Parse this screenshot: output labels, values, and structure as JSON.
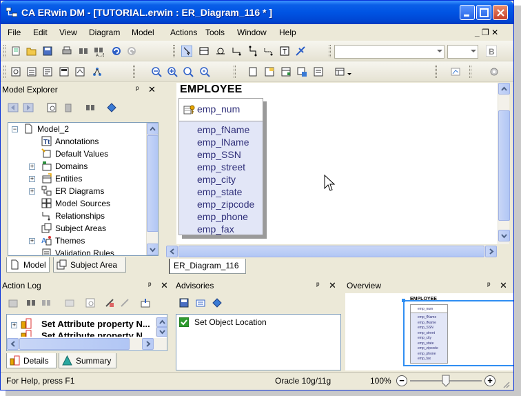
{
  "window": {
    "title": "CA ERwin DM - [TUTORIAL.erwin : ER_Diagram_116 * ]"
  },
  "menu": {
    "items": [
      "File",
      "Edit",
      "View",
      "Diagram",
      "Model",
      "Actions",
      "Tools",
      "Window",
      "Help"
    ],
    "mdi_controls": "_ ❐ ✕"
  },
  "model_explorer": {
    "title": "Model Explorer",
    "root": "Model_2",
    "items": [
      "Annotations",
      "Default Values",
      "Domains",
      "Entities",
      "ER Diagrams",
      "Model Sources",
      "Relationships",
      "Subject Areas",
      "Themes",
      "Validation Rules"
    ],
    "tabs": [
      "Model",
      "Subject Area"
    ]
  },
  "diagram": {
    "tab_label": "ER_Diagram_116",
    "entity": {
      "name": "EMPLOYEE",
      "key": "emp_num",
      "attributes": [
        "emp_fName",
        "emp_lName",
        "emp_SSN",
        "emp_street",
        "emp_city",
        "emp_state",
        "emp_zipcode",
        "emp_phone",
        "emp_fax"
      ]
    }
  },
  "action_log": {
    "title": "Action Log",
    "items": [
      "Set Attribute property N...",
      "Set Attribute property N..."
    ],
    "tabs": [
      "Details",
      "Summary"
    ]
  },
  "advisories": {
    "title": "Advisories",
    "items": [
      "Set Object Location"
    ]
  },
  "overview": {
    "title": "Overview",
    "entity_name": "EMPLOYEE",
    "key": "emp_num",
    "attributes": [
      "emp_fName",
      "emp_lName",
      "emp_SSN",
      "emp_street",
      "emp_city",
      "emp_state",
      "emp_zipcode",
      "emp_phone",
      "emp_fax"
    ]
  },
  "statusbar": {
    "help": "For Help, press F1",
    "database": "Oracle 10g/11g",
    "zoom": "100%",
    "zoom_minus": "−",
    "zoom_plus": "+"
  },
  "panel_controls": {
    "pin": "ᵖ",
    "close": "✕"
  },
  "colors": {
    "accent": "#0054e3",
    "entity_fill": "#e2e6f7",
    "attribute_text": "#30307a",
    "advisory_check": "#2e9b2e"
  }
}
